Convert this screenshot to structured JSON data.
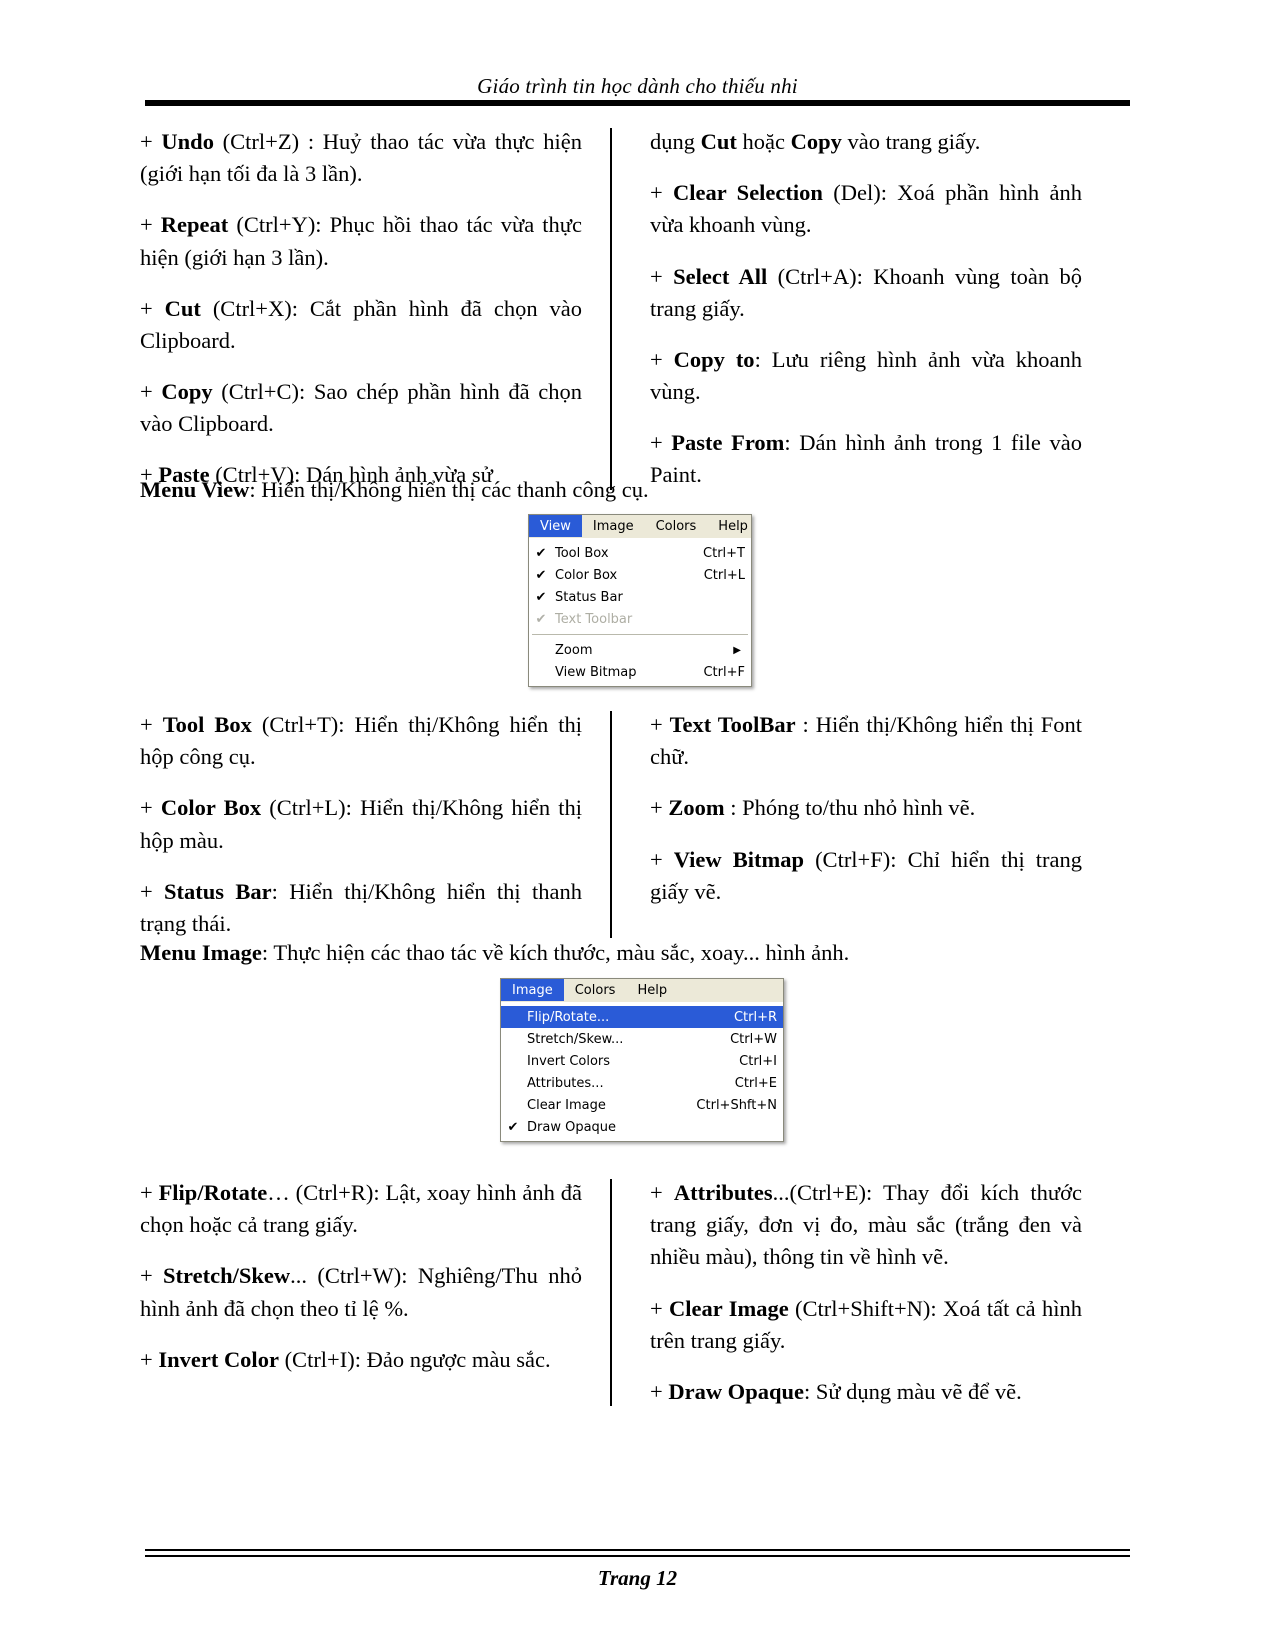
{
  "header": {
    "title": "Giáo trình tin học dành cho thiếu nhi"
  },
  "footer": {
    "page_label": "Trang 12"
  },
  "section_edit": {
    "left_paragraphs": [
      "+ Undo (Ctrl+Z) : Huỷ thao tác vừa thực hiện (giới hạn tối đa là 3 lần).",
      "+ Repeat (Ctrl+Y): Phục hồi thao tác vừa thực hiện (giới hạn 3 lần).",
      "+ Cut (Ctrl+X): Cắt phần hình đã chọn vào Clipboard.",
      "+ Copy (Ctrl+C): Sao chép phần hình đã chọn vào Clipboard.",
      "+ Paste (Ctrl+V): Dán hình ảnh vừa sử"
    ],
    "right_paragraphs": [
      "dụng Cut hoặc Copy vào trang giấy.",
      "+ Clear Selection (Del): Xoá phần hình ảnh vừa khoanh vùng.",
      "+ Select All (Ctrl+A): Khoanh vùng toàn bộ trang giấy.",
      "+ Copy to: Lưu riêng hình ảnh vừa khoanh vùng.",
      "+ Paste From: Dán hình ảnh trong 1 file vào Paint."
    ],
    "items": [
      {
        "bold": "Undo",
        "rest": " (Ctrl+Z) : Huỷ thao tác vừa thực hiện (giới hạn tối đa là 3 lần)."
      },
      {
        "bold": "Repeat",
        "rest": " (Ctrl+Y): Phục hồi thao tác vừa thực hiện (giới hạn 3 lần)."
      },
      {
        "bold": "Cut",
        "rest": " (Ctrl+X): Cắt phần hình đã chọn vào Clipboard."
      },
      {
        "bold": "Copy",
        "rest": " (Ctrl+C): Sao chép phần hình đã chọn vào Clipboard."
      },
      {
        "bold": "Paste",
        "rest": " (Ctrl+V): Dán hình ảnh vừa sử"
      },
      {
        "bold": "Clear Selection",
        "rest": " (Del): Xoá phần hình ảnh vừa khoanh vùng."
      },
      {
        "bold": "Select All",
        "rest": " (Ctrl+A): Khoanh vùng toàn bộ trang giấy."
      },
      {
        "bold": "Copy to",
        "rest": ": Lưu riêng hình ảnh vừa khoanh vùng."
      },
      {
        "bold": "Paste From",
        "rest": ": Dán hình ảnh trong 1 file vào Paint."
      }
    ]
  },
  "menu_view_intro": {
    "bold": "Menu View",
    "rest": ": Hiển thị/Không hiển thị các thanh công cụ."
  },
  "view_menu": {
    "menubar": [
      {
        "label": "View",
        "active": true
      },
      {
        "label": "Image",
        "active": false
      },
      {
        "label": "Colors",
        "active": false
      },
      {
        "label": "Help",
        "active": false
      }
    ],
    "items": [
      {
        "label": "Tool Box",
        "accel": "Ctrl+T",
        "checked": true,
        "disabled": false,
        "submenu": false
      },
      {
        "label": "Color Box",
        "accel": "Ctrl+L",
        "checked": true,
        "disabled": false,
        "submenu": false
      },
      {
        "label": "Status Bar",
        "accel": "",
        "checked": true,
        "disabled": false,
        "submenu": false
      },
      {
        "label": "Text Toolbar",
        "accel": "",
        "checked": true,
        "disabled": true,
        "submenu": false
      },
      {
        "separator": true
      },
      {
        "label": "Zoom",
        "accel": "",
        "checked": false,
        "disabled": false,
        "submenu": true
      },
      {
        "label": "View Bitmap",
        "accel": "Ctrl+F",
        "checked": false,
        "disabled": false,
        "submenu": false
      }
    ]
  },
  "section_view": {
    "left_paragraphs": [
      "+ Tool Box (Ctrl+T): Hiển thị/Không hiển thị hộp công cụ.",
      "+ Color Box (Ctrl+L): Hiển thị/Không hiển thị hộp màu.",
      "+ Status Bar: Hiển thị/Không hiển thị thanh trạng thái."
    ],
    "right_paragraphs": [
      "+ Text ToolBar : Hiển thị/Không hiển thị Font chữ.",
      "+ Zoom : Phóng to/thu nhỏ hình vẽ.",
      "+ View Bitmap (Ctrl+F): Chỉ hiển thị trang giấy vẽ."
    ],
    "items": [
      {
        "bold": "Tool Box",
        "rest": " (Ctrl+T): Hiển thị/Không hiển thị hộp công cụ."
      },
      {
        "bold": "Color Box",
        "rest": " (Ctrl+L): Hiển thị/Không hiển thị hộp màu."
      },
      {
        "bold": "Status Bar",
        "rest": ": Hiển thị/Không hiển thị thanh trạng thái."
      },
      {
        "bold": "Text ToolBar",
        "rest": " : Hiển thị/Không hiển thị Font chữ."
      },
      {
        "bold": "Zoom",
        "rest": " : Phóng to/thu nhỏ hình vẽ."
      },
      {
        "bold": "View Bitmap",
        "rest": " (Ctrl+F): Chỉ hiển thị trang giấy vẽ."
      }
    ]
  },
  "menu_image_intro": {
    "bold": "Menu Image",
    "rest": ": Thực hiện các thao tác về kích thước, màu sắc, xoay... hình ảnh."
  },
  "image_menu": {
    "menubar": [
      {
        "label": "Image",
        "active": true
      },
      {
        "label": "Colors",
        "active": false
      },
      {
        "label": "Help",
        "active": false
      }
    ],
    "items": [
      {
        "label": "Flip/Rotate...",
        "accel": "Ctrl+R",
        "checked": false,
        "selected": true
      },
      {
        "label": "Stretch/Skew...",
        "accel": "Ctrl+W",
        "checked": false,
        "selected": false
      },
      {
        "label": "Invert Colors",
        "accel": "Ctrl+I",
        "checked": false,
        "selected": false
      },
      {
        "label": "Attributes...",
        "accel": "Ctrl+E",
        "checked": false,
        "selected": false
      },
      {
        "label": "Clear Image",
        "accel": "Ctrl+Shft+N",
        "checked": false,
        "selected": false
      },
      {
        "label": "Draw Opaque",
        "accel": "",
        "checked": true,
        "selected": false
      }
    ]
  },
  "section_image": {
    "left_paragraphs": [
      "+ Flip/Rotate… (Ctrl+R): Lật, xoay hình ảnh đã chọn hoặc cả trang giấy.",
      "+ Stretch/Skew... (Ctrl+W): Nghiêng/Thu nhỏ hình ảnh đã chọn theo tỉ lệ %.",
      "+ Invert Color (Ctrl+I): Đảo ngược màu sắc."
    ],
    "right_paragraphs": [
      "+ Attributes...(Ctrl+E): Thay đổi kích thước trang giấy, đơn vị đo, màu sắc (trắng đen và nhiều màu), thông tin về hình vẽ.",
      "+ Clear Image (Ctrl+Shift+N): Xoá tất cả hình trên trang giấy.",
      "+ Draw Opaque: Sử dụng màu vẽ để vẽ."
    ],
    "items": [
      {
        "bold": "Flip/Rotate",
        "rest": "… (Ctrl+R): Lật, xoay hình ảnh đã chọn hoặc cả trang giấy."
      },
      {
        "bold": "Stretch/Skew",
        "rest": "... (Ctrl+W): Nghiêng/Thu nhỏ hình ảnh đã chọn theo tỉ lệ %."
      },
      {
        "bold": "Invert Color",
        "rest": " (Ctrl+I): Đảo ngược màu sắc."
      },
      {
        "bold": "Attributes",
        "rest": "...(Ctrl+E): Thay đổi kích thước trang giấy, đơn vị đo, màu sắc (trắng đen và nhiều màu), thông tin về hình vẽ."
      },
      {
        "bold": "Clear Image",
        "rest": " (Ctrl+Shift+N): Xoá tất cả hình trên trang giấy."
      },
      {
        "bold": "Draw Opaque",
        "rest": ": Sử dụng màu vẽ để vẽ."
      }
    ]
  },
  "colors": {
    "menu_highlight": "#2a5bd7",
    "menubar_bg": "#ece9d8",
    "disabled_text": "#aeaea4"
  }
}
